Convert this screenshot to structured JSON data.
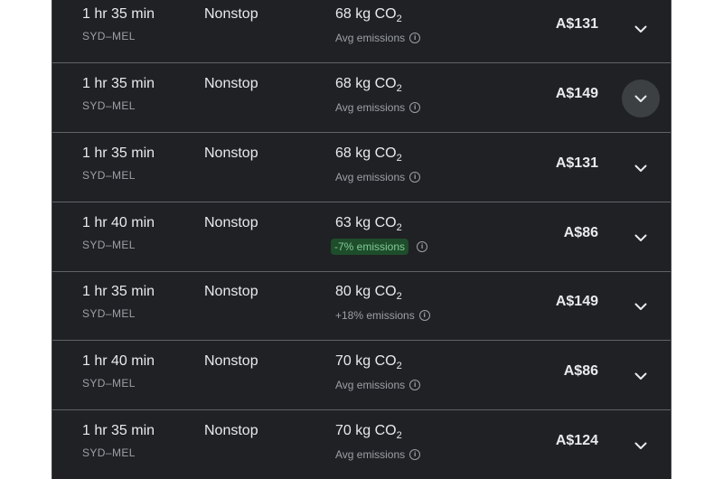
{
  "flights": [
    {
      "duration": "1 hr 35 min",
      "route": "SYD–MEL",
      "stops": "Nonstop",
      "co2_value": "68 kg CO",
      "co2_sub": "2",
      "emissions": "Avg emissions",
      "emissions_style": "neutral",
      "price": "A$131"
    },
    {
      "duration": "1 hr 35 min",
      "route": "SYD–MEL",
      "stops": "Nonstop",
      "co2_value": "68 kg CO",
      "co2_sub": "2",
      "emissions": "Avg emissions",
      "emissions_style": "neutral",
      "price": "A$149",
      "expand_hovered": true
    },
    {
      "duration": "1 hr 35 min",
      "route": "SYD–MEL",
      "stops": "Nonstop",
      "co2_value": "68 kg CO",
      "co2_sub": "2",
      "emissions": "Avg emissions",
      "emissions_style": "neutral",
      "price": "A$131"
    },
    {
      "duration": "1 hr 40 min",
      "route": "SYD–MEL",
      "stops": "Nonstop",
      "co2_value": "63 kg CO",
      "co2_sub": "2",
      "emissions": "-7% emissions",
      "emissions_style": "lower",
      "price": "A$86"
    },
    {
      "duration": "1 hr 35 min",
      "route": "SYD–MEL",
      "stops": "Nonstop",
      "co2_value": "80 kg CO",
      "co2_sub": "2",
      "emissions": "+18% emissions",
      "emissions_style": "neutral",
      "price": "A$149"
    },
    {
      "duration": "1 hr 40 min",
      "route": "SYD–MEL",
      "stops": "Nonstop",
      "co2_value": "70 kg CO",
      "co2_sub": "2",
      "emissions": "Avg emissions",
      "emissions_style": "neutral",
      "price": "A$86"
    },
    {
      "duration": "1 hr 35 min",
      "route": "SYD–MEL",
      "stops": "Nonstop",
      "co2_value": "70 kg CO",
      "co2_sub": "2",
      "emissions": "Avg emissions",
      "emissions_style": "neutral",
      "price": "A$124"
    }
  ],
  "icons": {
    "info": "info-icon",
    "expand": "chevron-down-icon"
  },
  "colors": {
    "background": "#202124",
    "text": "#e8eaed",
    "secondary": "#9aa0a6",
    "lower_emissions_bg": "#1e4d2b",
    "lower_emissions_text": "#81c995",
    "divider": "#5f6368"
  }
}
